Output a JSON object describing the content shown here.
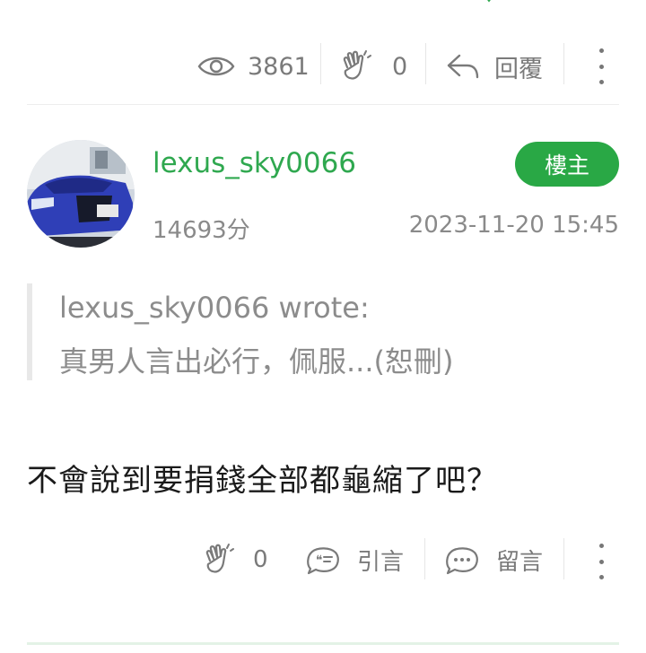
{
  "post_stats": {
    "views": "3861",
    "likes": "0",
    "reply_label": "回覆"
  },
  "reply": {
    "username": "lexus_sky0066",
    "badge": "樓主",
    "score": "14693分",
    "timestamp": "2023-11-20 15:45",
    "quote": {
      "author_line": "lexus_sky0066 wrote:",
      "excerpt": "真男人言出必行，佩服...(恕刪)"
    },
    "content": "不會說到要捐錢全部都龜縮了吧？",
    "actions": {
      "likes": "0",
      "quote_label": "引言",
      "comment_label": "留言"
    }
  },
  "colors": {
    "accent_green": "#29a845",
    "username_green": "#2fa84f",
    "muted_text": "#7a7a7a"
  },
  "icons": [
    "chevron-down-icon",
    "eye-icon",
    "clap-icon",
    "reply-arrow-icon",
    "more-vertical-icon",
    "quote-bubble-icon",
    "comment-bubble-icon"
  ]
}
